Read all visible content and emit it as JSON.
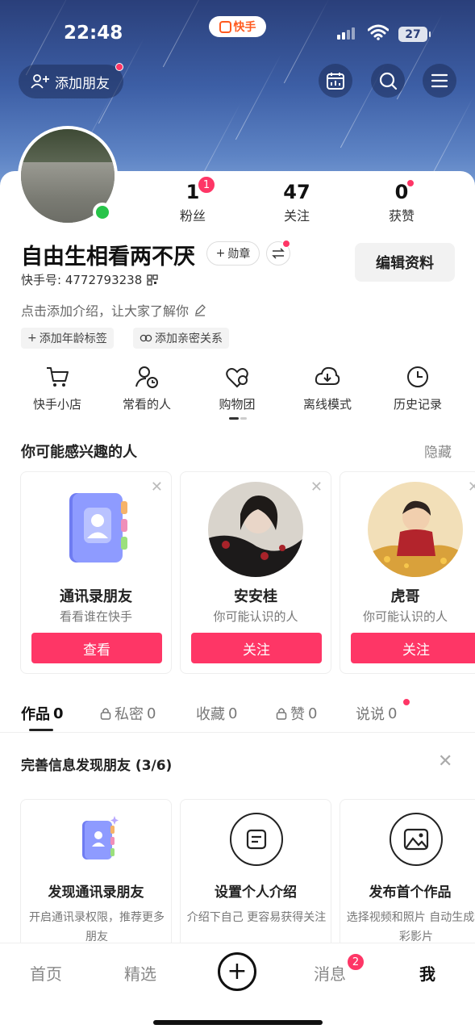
{
  "status_bar": {
    "time": "22:48",
    "app_pill": "快手",
    "battery": "27"
  },
  "header": {
    "add_friend_label": "添加朋友",
    "icons": [
      "person-add-icon",
      "calendar-icon",
      "search-icon",
      "menu-icon"
    ]
  },
  "profile": {
    "stats": [
      {
        "value": "1",
        "label": "粉丝",
        "badge": "1"
      },
      {
        "value": "47",
        "label": "关注"
      },
      {
        "value": "0",
        "label": "获赞"
      }
    ],
    "name": "自由生相看两不厌",
    "medal_label": "勋章",
    "edit_label": "编辑资料",
    "kuaishou_id": "快手号: 4772793238",
    "intro_placeholder": "点击添加介绍，让大家了解你",
    "tags": [
      "添加年龄标签",
      "添加亲密关系"
    ]
  },
  "quick_actions": [
    {
      "label": "快手小店",
      "icon": "cart-icon"
    },
    {
      "label": "常看的人",
      "icon": "user-clock-icon"
    },
    {
      "label": "购物团",
      "icon": "heart-group-icon"
    },
    {
      "label": "离线模式",
      "icon": "cloud-download-icon"
    },
    {
      "label": "历史记录",
      "icon": "clock-icon"
    }
  ],
  "suggestions": {
    "title": "你可能感兴趣的人",
    "hide_label": "隐藏",
    "people": [
      {
        "name": "通讯录朋友",
        "subtitle": "看看谁在快手",
        "button": "查看"
      },
      {
        "name": "安安桂",
        "subtitle": "你可能认识的人",
        "button": "关注"
      },
      {
        "name": "虎哥",
        "subtitle": "你可能认识的人",
        "button": "关注"
      }
    ]
  },
  "content_tabs": [
    {
      "label": "作品",
      "count": "0",
      "active": true
    },
    {
      "label": "私密",
      "count": "0",
      "locked": true
    },
    {
      "label": "收藏",
      "count": "0"
    },
    {
      "label": "赞",
      "count": "0",
      "locked": true
    },
    {
      "label": "说说",
      "count": "0",
      "dot": true
    }
  ],
  "complete_info": {
    "title": "完善信息发现朋友 (3/6)",
    "cards": [
      {
        "title": "发现通讯录朋友",
        "desc": "开启通讯录权限，推荐更多朋友",
        "icon": "contacts-book-icon"
      },
      {
        "title": "设置个人介绍",
        "desc": "介绍下自己 更容易获得关注",
        "icon": "note-icon"
      },
      {
        "title": "发布首个作品",
        "desc": "选择视频和照片 自动生成精彩影片",
        "icon": "image-icon"
      }
    ]
  },
  "bottom_nav": {
    "items": [
      "首页",
      "精选",
      "消息",
      "我"
    ],
    "message_badge": "2",
    "active": "我"
  },
  "colors": {
    "accent": "#fe3666",
    "online": "#27c449"
  }
}
